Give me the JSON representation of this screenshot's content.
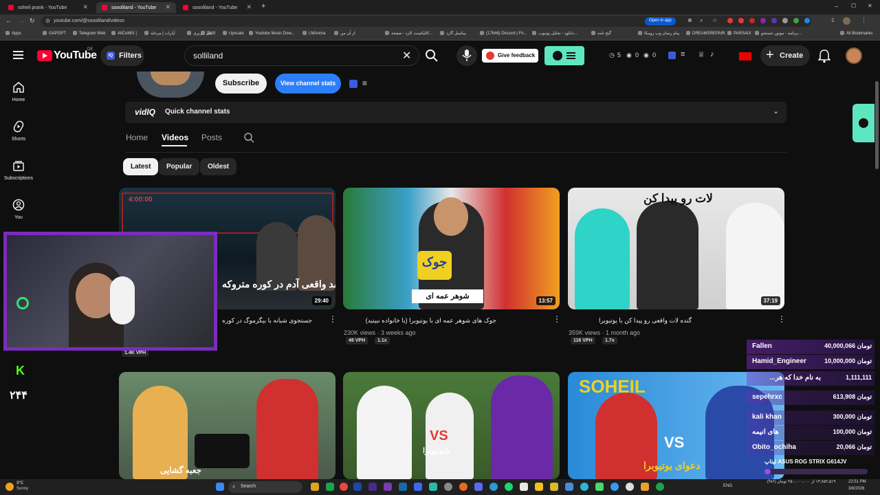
{
  "tabs": [
    {
      "title": "soheil prank - YouTube"
    },
    {
      "title": "soooliland - YouTube"
    },
    {
      "title": "soooliland - YouTube"
    }
  ],
  "window_controls": {
    "minimize": "–",
    "maximize": "☐",
    "close": "✕"
  },
  "address": {
    "url": "youtube.com/@soooliland/videos",
    "open_in_app": "Open in app"
  },
  "bookmarks": [
    {
      "label": "Apps"
    },
    {
      "label": "GAPGPT"
    },
    {
      "label": "Telegram Web"
    },
    {
      "label": "AliCoMiX |"
    },
    {
      "label": "آپارات | مرحله"
    },
    {
      "label": "پنل کاربری"
    },
    {
      "label": "DNS"
    },
    {
      "label": "Upscale"
    },
    {
      "label": "Youtube Music Dow..."
    },
    {
      "label": "LMArena"
    },
    {
      "label": "از آن من"
    },
    {
      "label": "کالیکست کارد - صفحه..."
    },
    {
      "label": "پیکسل گارد"
    },
    {
      "label": "(17646) Discord | Fri..."
    },
    {
      "label": "دانلود - تحلیل یوتیوب..."
    },
    {
      "label": "گنج نامه"
    },
    {
      "label": "پیام رسان وب روبیکا"
    },
    {
      "label": "DREAMSREPAIR"
    },
    {
      "label": "PARSAIX"
    },
    {
      "label": "برنامه - موتور جستجو..."
    },
    {
      "label": "All Bookmarks"
    }
  ],
  "header": {
    "logo_text": "YouTube",
    "country": "DE",
    "filters_label": "Filters",
    "search_value": "solliland",
    "feedback_label": "Give feedback",
    "stats": {
      "a": "5",
      "b": "0",
      "c": "0"
    },
    "create_label": "Create"
  },
  "sidebar": {
    "items": [
      {
        "label": "Home"
      },
      {
        "label": "Shorts"
      },
      {
        "label": "Subscriptions"
      },
      {
        "label": "You"
      }
    ]
  },
  "channel": {
    "subscribe_label": "Subscribe",
    "view_stats_label": "View channel stats",
    "vidiq_label": "vidIQ",
    "quick_stats_label": "Quick channel stats",
    "tabs": [
      {
        "label": "Home"
      },
      {
        "label": "Videos"
      },
      {
        "label": "Posts"
      }
    ],
    "chips": [
      {
        "label": "Latest"
      },
      {
        "label": "Popular"
      },
      {
        "label": "Oldest"
      }
    ]
  },
  "videos": [
    {
      "title": "جستجوی شبانه با بیگزموگ در کوره",
      "duration": "29:40",
      "views": "",
      "age": "",
      "vph": "1.4K VPH",
      "mult": "",
      "overlay": "جسد واقعی آدم در کوره متروکه",
      "timer": "4:00:00"
    },
    {
      "title": "جوک های شوهر عمه ای با یوتیوبرا (با خانواده نبینید) ",
      "duration": "13:57",
      "views": "230K views",
      "age": "3 weeks ago",
      "vph": "49 VPH",
      "mult": "1.1x",
      "overlay": "شوهر عمه ای",
      "badge": "جوک"
    },
    {
      "title": "گنده لات واقعی رو پیدا کن با یوتیوبرا",
      "duration": "37:19",
      "views": "359K views",
      "age": "1 month ago",
      "vph": "116 VPH",
      "mult": "1.7x",
      "overlay": "لات رو پیدا کن"
    },
    {
      "title": "",
      "duration": "",
      "overlay": "جعبه گشایی"
    },
    {
      "title": "",
      "duration": "",
      "overlay": "بایوتیوبرا",
      "badge": "VS"
    },
    {
      "title": "",
      "duration": "",
      "overlay": "دعوای یوتیوبرا",
      "badge": "VS"
    }
  ],
  "stream_overlay": {
    "kick_count": "۲۴۴"
  },
  "donations": [
    {
      "name": "Fallen",
      "amount": "40,000,066 تومان"
    },
    {
      "name": "Hamid_Engineer",
      "amount": "10,000,000 تومان"
    },
    {
      "name": "به نام خدا که هر...",
      "amount": "1,111,111"
    },
    {
      "name": "sepehrxc",
      "amount": "613,908 تومان"
    },
    {
      "name": "kali khan",
      "amount": "300,000 تومان"
    },
    {
      "name": "های انیمه",
      "amount": "100,000 تومان"
    },
    {
      "name": "Obito_ochiha",
      "amount": "20,066 تومان"
    },
    {
      "name": "لپتاپ ASUS ROG STRIX G614JV",
      "amount": ""
    },
    {
      "name": "۱۳,۸۵۲,۵۱۹ از ۲۵۰,۰۰۰,۰۰۰ تومان (۶%)",
      "amount": ""
    }
  ],
  "taskbar": {
    "weather": "3°C",
    "weather_desc": "Sunny",
    "search_label": "Search",
    "lang": "ENG",
    "time": "22:51 PM",
    "date": "3/8/2026"
  },
  "colors": {
    "accent_blue": "#3ea6ff",
    "view_stats_blue": "#2d7ff9",
    "youtube_red": "#ff0033",
    "vidiq_teal": "#5ee6c0",
    "stream_purple": "#7b2cbf"
  }
}
